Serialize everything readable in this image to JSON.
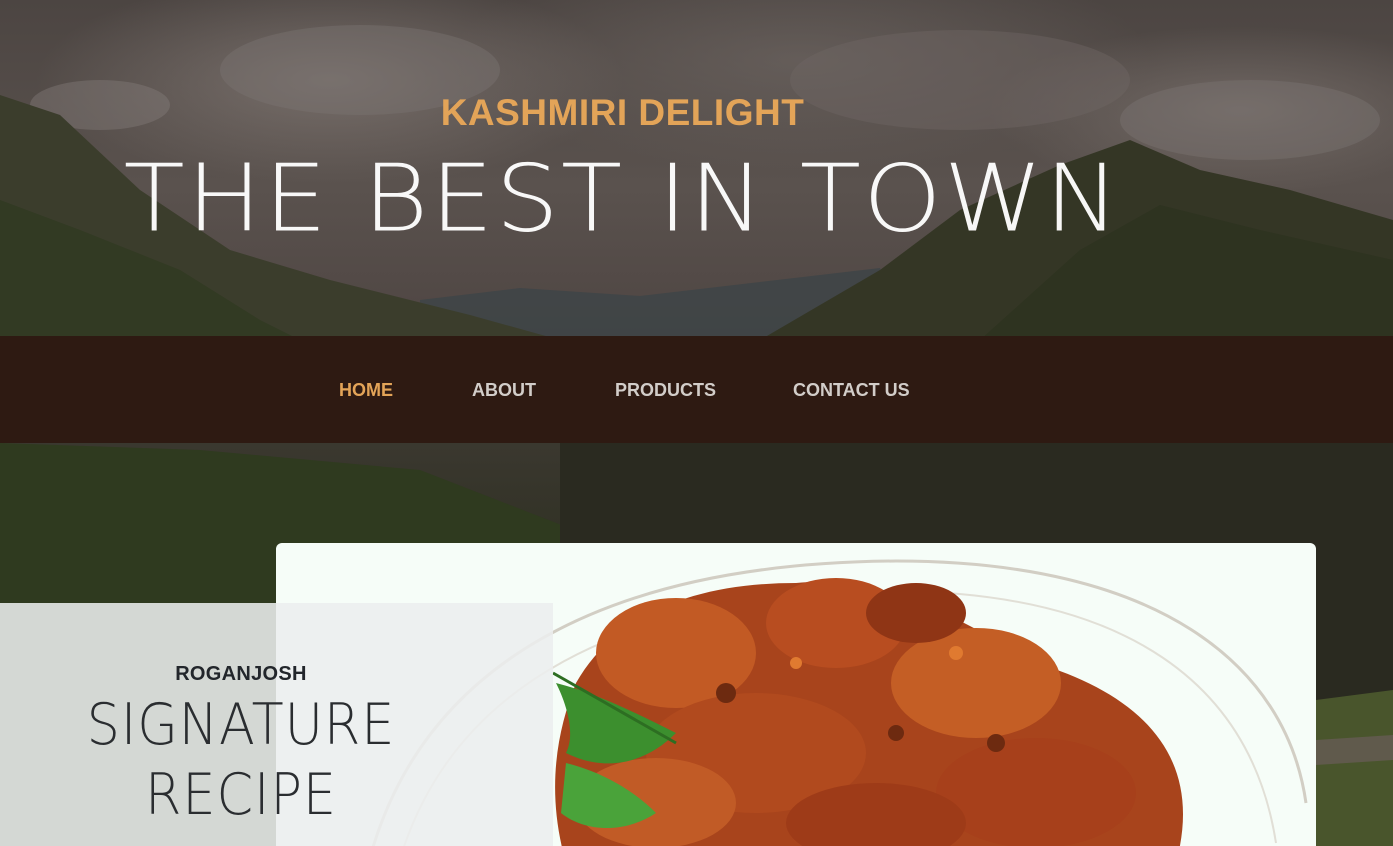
{
  "hero": {
    "brand": "KASHMIRI DELIGHT",
    "tagline": "THE BEST IN TOWN"
  },
  "nav": {
    "items": [
      {
        "label": "HOME",
        "active": true
      },
      {
        "label": "ABOUT",
        "active": false
      },
      {
        "label": "PRODUCTS",
        "active": false
      },
      {
        "label": "CONTACT US",
        "active": false
      }
    ]
  },
  "feature": {
    "kicker": "ROGANJOSH",
    "title_line1": "SIGNATURE",
    "title_line2": "RECIPE"
  },
  "colors": {
    "accent": "#e3a458",
    "navbar": "#2e1a12",
    "nav_text": "#d2cdc9"
  }
}
